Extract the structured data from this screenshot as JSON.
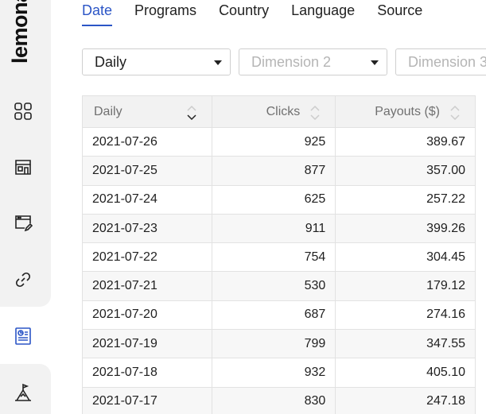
{
  "brand": {
    "logo_text": "lemona"
  },
  "sidebar": {
    "items": [
      {
        "icon": "grid-icon"
      },
      {
        "icon": "store-icon"
      },
      {
        "icon": "browser-edit-icon"
      },
      {
        "icon": "link-icon"
      },
      {
        "icon": "report-icon",
        "active": true
      },
      {
        "icon": "campaign-flag-icon"
      }
    ]
  },
  "tabs": [
    {
      "label": "Date",
      "active": true
    },
    {
      "label": "Programs"
    },
    {
      "label": "Country"
    },
    {
      "label": "Language"
    },
    {
      "label": "Source"
    }
  ],
  "filters": {
    "dimension1": {
      "value": "Daily"
    },
    "dimension2": {
      "placeholder": "Dimension 2"
    },
    "dimension3": {
      "placeholder": "Dimension 3"
    }
  },
  "table": {
    "headers": {
      "date": "Daily",
      "clicks": "Clicks",
      "payouts": "Payouts ($)"
    },
    "rows": [
      {
        "date": "2021-07-26",
        "clicks": "925",
        "payouts": "389.67"
      },
      {
        "date": "2021-07-25",
        "clicks": "877",
        "payouts": "357.00"
      },
      {
        "date": "2021-07-24",
        "clicks": "625",
        "payouts": "257.22"
      },
      {
        "date": "2021-07-23",
        "clicks": "911",
        "payouts": "399.26"
      },
      {
        "date": "2021-07-22",
        "clicks": "754",
        "payouts": "304.45"
      },
      {
        "date": "2021-07-21",
        "clicks": "530",
        "payouts": "179.12"
      },
      {
        "date": "2021-07-20",
        "clicks": "687",
        "payouts": "274.16"
      },
      {
        "date": "2021-07-19",
        "clicks": "799",
        "payouts": "347.55"
      },
      {
        "date": "2021-07-18",
        "clicks": "932",
        "payouts": "405.10"
      },
      {
        "date": "2021-07-17",
        "clicks": "830",
        "payouts": "247.18"
      }
    ]
  },
  "colors": {
    "accent": "#2b55c6",
    "sidebar_bg": "#f2f2f2",
    "header_bg": "#f2f2f2"
  }
}
